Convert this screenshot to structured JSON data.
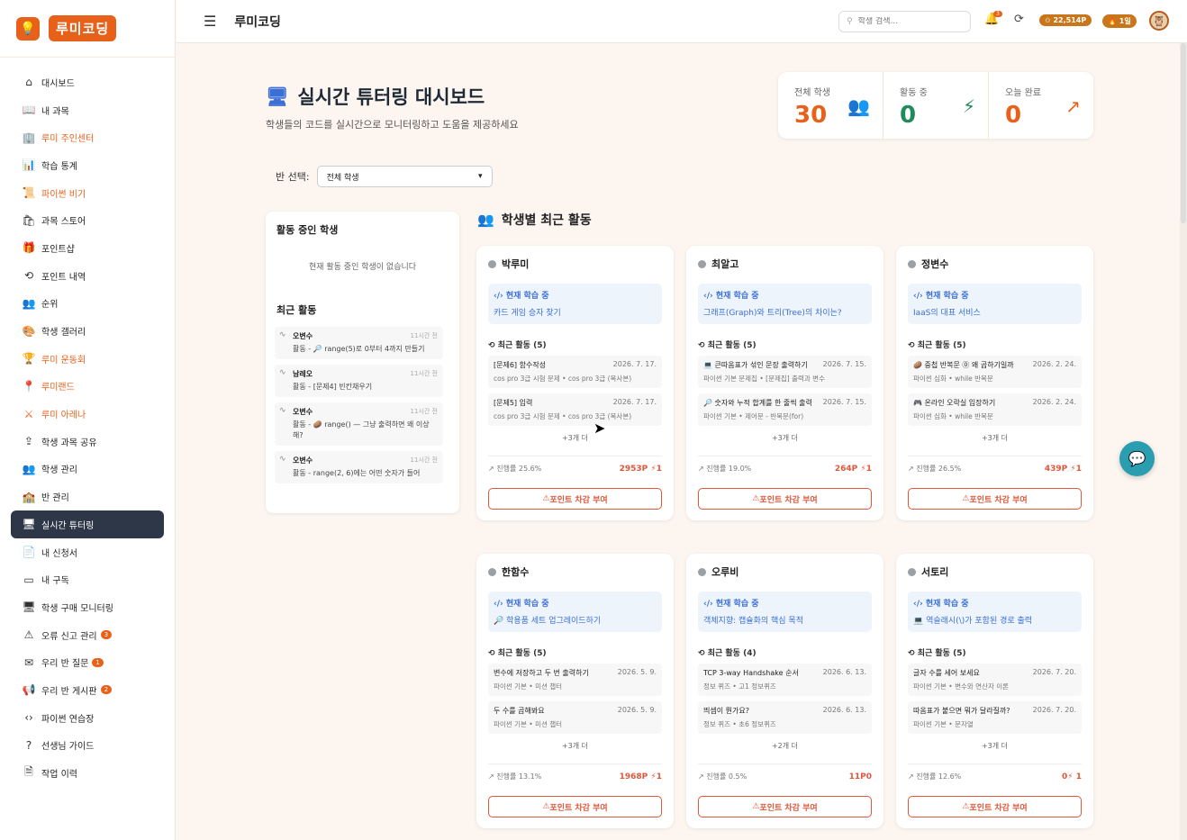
{
  "app": {
    "logo_text": "루미코딩",
    "page_name": "루미코딩"
  },
  "colors": {
    "accent": "#e8611a",
    "blue": "#3b6fd6",
    "green": "#1f8a5b",
    "active_nav": "#2d3748",
    "danger": "#e0573a"
  },
  "sidebar": {
    "items": [
      {
        "label": "대시보드",
        "icon": "home-icon",
        "orange": false
      },
      {
        "label": "내 과목",
        "icon": "book-icon",
        "orange": false
      },
      {
        "label": "루미 주인센터",
        "icon": "building-icon",
        "orange": true
      },
      {
        "label": "학습 통계",
        "icon": "bar-chart-icon",
        "orange": false
      },
      {
        "label": "파이썬 비기",
        "icon": "scroll-icon",
        "orange": true
      },
      {
        "label": "과목 스토어",
        "icon": "store-icon",
        "orange": false
      },
      {
        "label": "포인트샵",
        "icon": "gift-icon",
        "orange": false
      },
      {
        "label": "포인트 내역",
        "icon": "history-icon",
        "orange": false
      },
      {
        "label": "순위",
        "icon": "users-icon",
        "orange": false
      },
      {
        "label": "학생 갤러리",
        "icon": "palette-icon",
        "orange": false
      },
      {
        "label": "루미 운동회",
        "icon": "trophy-icon",
        "orange": true
      },
      {
        "label": "루미랜드",
        "icon": "map-pin-icon",
        "orange": true
      },
      {
        "label": "루미 아레나",
        "icon": "swords-icon",
        "orange": true
      },
      {
        "label": "학생 과목 공유",
        "icon": "share-icon",
        "orange": false
      },
      {
        "label": "학생 관리",
        "icon": "users-icon",
        "orange": false
      },
      {
        "label": "반 관리",
        "icon": "school-icon",
        "orange": false
      },
      {
        "label": "실시간 튜터링",
        "icon": "monitor-icon",
        "orange": false,
        "active": true
      },
      {
        "label": "내 신청서",
        "icon": "document-icon",
        "orange": false
      },
      {
        "label": "내 구독",
        "icon": "card-icon",
        "orange": false
      },
      {
        "label": "학생 구매 모니터링",
        "icon": "monitor-icon",
        "orange": false
      },
      {
        "label": "오류 신고 관리",
        "icon": "warning-icon",
        "orange": false,
        "badge": "3"
      },
      {
        "label": "우리 반 질문",
        "icon": "mail-icon",
        "orange": false,
        "badge": "1"
      },
      {
        "label": "우리 반 게시판",
        "icon": "megaphone-icon",
        "orange": false,
        "badge": "2"
      },
      {
        "label": "파이썬 연습장",
        "icon": "code-icon",
        "orange": false
      },
      {
        "label": "선생님 가이드",
        "icon": "help-icon",
        "orange": false
      },
      {
        "label": "작업 이력",
        "icon": "file-icon",
        "orange": false
      }
    ]
  },
  "topbar": {
    "search_placeholder": "학생 검색...",
    "bell_count": "3",
    "points": "✩ 22,514P",
    "rank": "🔥 1일"
  },
  "header": {
    "title": "실시간 튜터링 대시보드",
    "subtitle": "학생들의 코드를 실시간으로 모니터링하고 도움을 제공하세요"
  },
  "stats": [
    {
      "label": "전체 학생",
      "value": "30",
      "color": "#e8611a",
      "icon": "users-icon"
    },
    {
      "label": "활동 중",
      "value": "0",
      "color": "#1f8a5b",
      "icon": "activity-icon"
    },
    {
      "label": "오늘 완료",
      "value": "0",
      "color": "#e8611a",
      "icon": "trending-up-icon"
    }
  ],
  "class_select": {
    "label": "반 선택:",
    "value": "전체 학생"
  },
  "left_panel": {
    "active_title": "활동 중인 학생",
    "empty_text": "현재 활동 중인 학생이 없습니다",
    "recent_title": "최근 활동",
    "items": [
      {
        "name": "오변수",
        "time": "11시간 전",
        "text": "활동 - 🔎 range(5)로 0부터 4까지 만들기"
      },
      {
        "name": "남레오",
        "time": "11시간 전",
        "text": "활동 - [문제4] 빈칸채우기"
      },
      {
        "name": "오변수",
        "time": "11시간 전",
        "text": "활동 - 🥔 range() — 그냥 출력하면 왜 이상해?"
      },
      {
        "name": "오변수",
        "time": "11시간 전",
        "text": "활동 - range(2, 6)에는 어떤 숫자가 들어"
      }
    ]
  },
  "section_title": "학생별 최근 활동",
  "labels": {
    "learning": "현재 학습 중",
    "more_prefix": "+",
    "more_suffix": "개 더",
    "progress_prefix": "진행률 ",
    "button": "포인트 차감 부여"
  },
  "cards": [
    {
      "name": "박루미",
      "learning": "카드 게임 승자 찾기",
      "recent_label": "최근 활동 (5)",
      "items": [
        {
          "title": "[문제6] 함수작성",
          "date": "2026. 7. 17.",
          "sub": "cos pro 3급 시험 문제 • cos pro 3급 (복사본)"
        },
        {
          "title": "[문제5] 입력",
          "date": "2026. 7. 17.",
          "sub": "cos pro 3급 시험 문제 • cos pro 3급 (복사본)"
        }
      ],
      "more": "+3개 더",
      "progress": "진행률 25.6%",
      "points": "2953P ⚡1"
    },
    {
      "name": "최알고",
      "learning": "그래프(Graph)와 트리(Tree)의 차이는?",
      "recent_label": "최근 활동 (5)",
      "items": [
        {
          "title": "💻 큰따옴표가 섞인 문장 출력하기",
          "date": "2026. 7. 15.",
          "sub": "파이썬 기본 문제집 • [문제집] 출력과 변수"
        },
        {
          "title": "🔎 숫자와 누적 합계를 한 줄씩 출력",
          "date": "2026. 7. 15.",
          "sub": "파이썬 기본 • 제어문 - 반복문(for)"
        }
      ],
      "more": "+3개 더",
      "progress": "진행률 19.0%",
      "points": "264P ⚡1"
    },
    {
      "name": "정변수",
      "learning": "IaaS의 대표 서비스",
      "recent_label": "최근 활동 (5)",
      "items": [
        {
          "title": "🥔 중첩 반복문 ⓪ 왜 곱하기일까",
          "date": "2026. 2. 24.",
          "sub": "파이썬 심화 • while 반복문"
        },
        {
          "title": "🎮 온라인 오락실 입장하기",
          "date": "2026. 2. 24.",
          "sub": "파이썬 심화 • while 반복문"
        }
      ],
      "more": "+3개 더",
      "progress": "진행률 26.5%",
      "points": "439P ⚡1"
    },
    {
      "name": "한함수",
      "learning": "🔎 학용품 세트 업그레이드하기",
      "recent_label": "최근 활동 (5)",
      "items": [
        {
          "title": "변수에 저장하고 두 번 출력하기",
          "date": "2026. 5. 9.",
          "sub": "파이썬 기본 • 미션 챕터"
        },
        {
          "title": "두 수를 곱해봐요",
          "date": "2026. 5. 9.",
          "sub": "파이썬 기본 • 미션 챕터"
        }
      ],
      "more": "+3개 더",
      "progress": "진행률 13.1%",
      "points": "1968P ⚡1"
    },
    {
      "name": "오루비",
      "learning": "객체지향: 캡슐화의 핵심 목적",
      "recent_label": "최근 활동 (4)",
      "items": [
        {
          "title": "TCP 3-way Handshake 순서",
          "date": "2026. 6. 13.",
          "sub": "정보 퀴즈 • 고1 정보퀴즈"
        },
        {
          "title": "띄셈이 뭔가요?",
          "date": "2026. 6. 13.",
          "sub": "정보 퀴즈 • 초6 정보퀴즈"
        }
      ],
      "more": "+2개 더",
      "progress": "진행률 0.5%",
      "points": "11P0"
    },
    {
      "name": "서토리",
      "learning": "💻 역슬래시(\\)가 포함된 경로 출력",
      "recent_label": "최근 활동 (5)",
      "items": [
        {
          "title": "글자 수를 세어 보세요",
          "date": "2026. 7. 20.",
          "sub": "파이썬 기본 • 변수와 연산자 이론"
        },
        {
          "title": "따옴표가 붙으면 뭐가 달라질까?",
          "date": "2026. 7. 20.",
          "sub": "파이썬 기본 • 문자열"
        }
      ],
      "more": "+3개 더",
      "progress": "진행률 12.6%",
      "points": "0⚡ 1"
    }
  ]
}
